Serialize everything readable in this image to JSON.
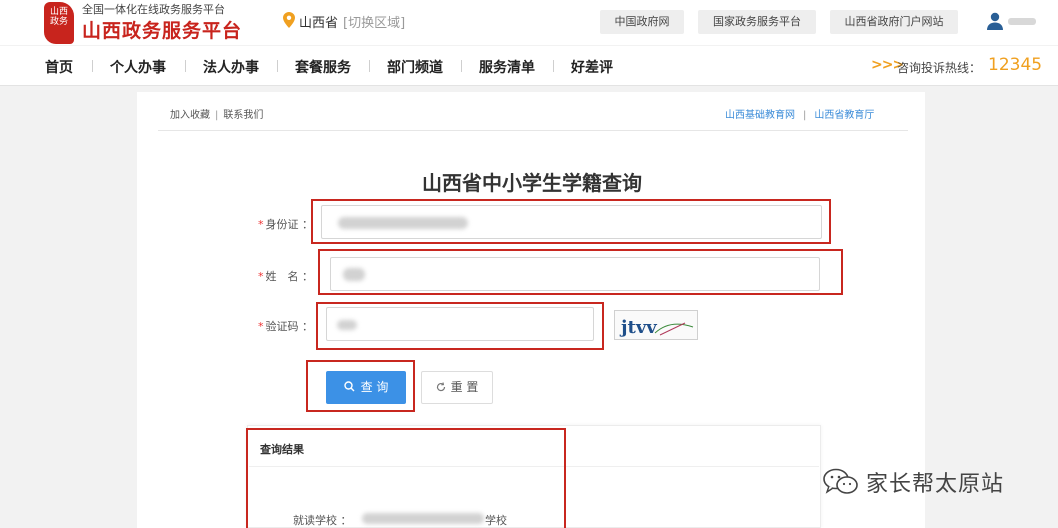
{
  "header": {
    "logo_seal_text": "山西政务",
    "slogan": "全国一体化在线政务服务平台",
    "site_title": "山西政务服务平台",
    "location": {
      "province": "山西省",
      "switch_label": "[切换区域]"
    },
    "links": [
      "中国政府网",
      "国家政务服务平台",
      "山西省政府门户网站"
    ],
    "brand_color": "#c8241d"
  },
  "nav": {
    "items": [
      "首页",
      "个人办事",
      "法人办事",
      "套餐服务",
      "部门频道",
      "服务清单",
      "好差评"
    ],
    "hotline_arrows": ">>>",
    "hotline_label": "咨询投诉热线：",
    "hotline_number": "12345",
    "hotline_color": "#f0a020"
  },
  "subbar": {
    "left": [
      "加入收藏",
      "联系我们"
    ],
    "separator": "|",
    "right": [
      "山西基础教育网",
      "山西省教育厅"
    ],
    "link_color": "#3a8bd8"
  },
  "form": {
    "title": "山西省中小学生学籍查询",
    "required_mark": "*",
    "fields": [
      {
        "label": "身份证 ："
      },
      {
        "label": "姓　名 ："
      },
      {
        "label": "验证码 ："
      }
    ],
    "captcha_text": "jtvv",
    "query_button": "查 询",
    "reset_button": "重 置",
    "primary_color": "#3c91e6"
  },
  "result": {
    "title": "查询结果",
    "school_label": "就读学校 ：",
    "school_suffix": "学校"
  },
  "watermark": {
    "text": "家长帮太原站"
  }
}
